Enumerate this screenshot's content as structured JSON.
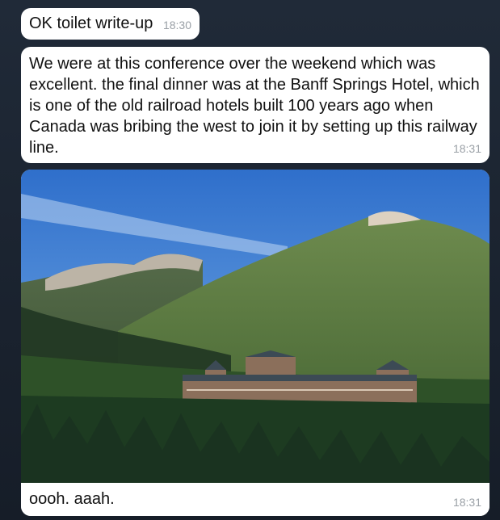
{
  "messages": [
    {
      "text": "OK toilet write-up",
      "time": "18:30"
    },
    {
      "text": "We were at this conference over the weekend which was excellent. the final dinner was at the Banff Springs Hotel, which is one of the old railroad hotels built 100 years ago when Canada was bribing the west to join it by setting up this railway line.",
      "time": "18:31"
    },
    {
      "caption": "oooh. aaah.",
      "time": "18:31"
    }
  ]
}
